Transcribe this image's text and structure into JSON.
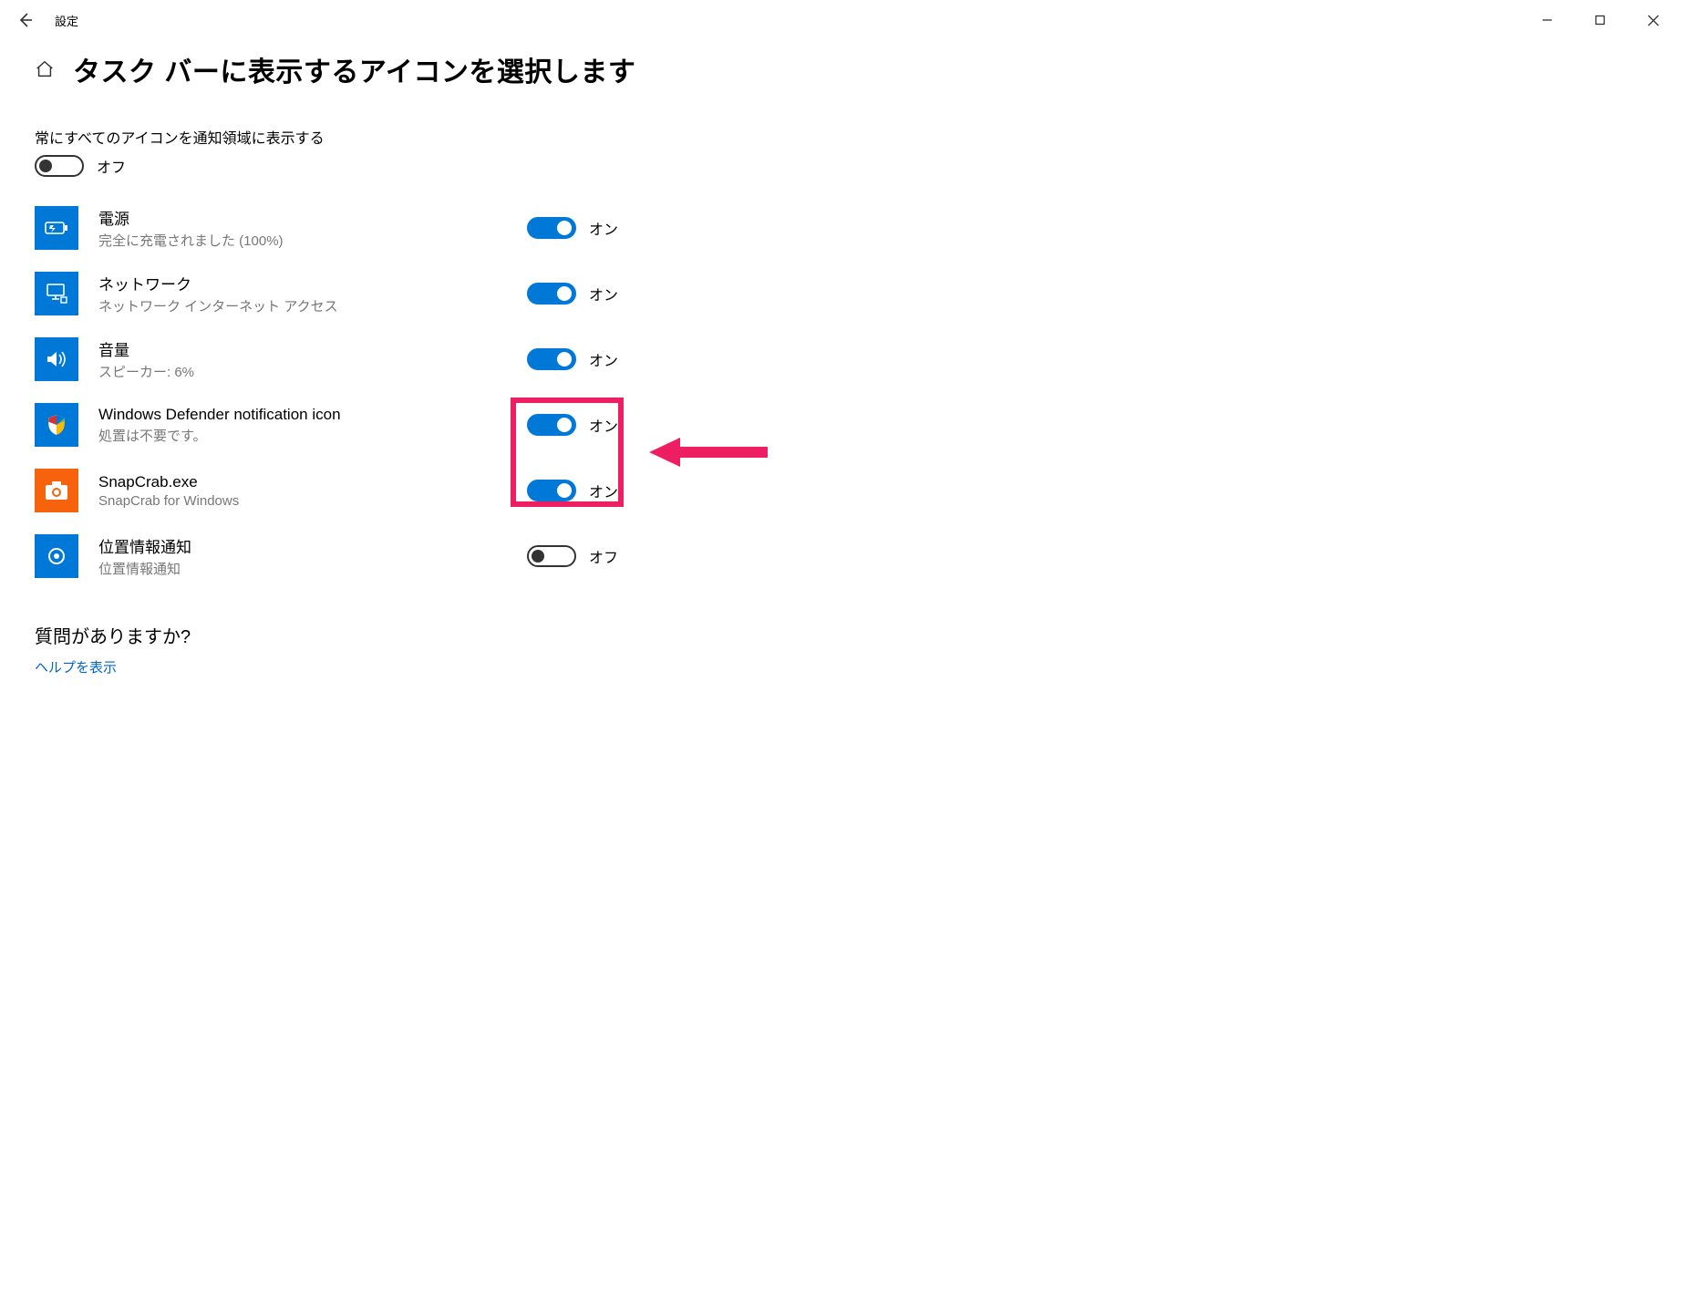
{
  "appTitle": "設定",
  "pageTitle": "タスク バーに表示するアイコンを選択します",
  "masterLabel": "常にすべてのアイコンを通知領域に表示する",
  "masterToggle": {
    "on": false,
    "label": "オフ"
  },
  "onLabel": "オン",
  "offLabel": "オフ",
  "items": [
    {
      "title": "電源",
      "sub": "完全に充電されました (100%)",
      "on": true,
      "icon": "battery"
    },
    {
      "title": "ネットワーク",
      "sub": "ネットワーク インターネット アクセス",
      "on": true,
      "icon": "network"
    },
    {
      "title": "音量",
      "sub": "スピーカー: 6%",
      "on": true,
      "icon": "volume"
    },
    {
      "title": "Windows Defender notification icon",
      "sub": "処置は不要です。",
      "on": true,
      "icon": "defender"
    },
    {
      "title": "SnapCrab.exe",
      "sub": "SnapCrab for Windows",
      "on": true,
      "icon": "snapcrab"
    },
    {
      "title": "位置情報通知",
      "sub": "位置情報通知",
      "on": false,
      "icon": "location"
    }
  ],
  "helpTitle": "質問がありますか?",
  "helpLink": "ヘルプを表示"
}
